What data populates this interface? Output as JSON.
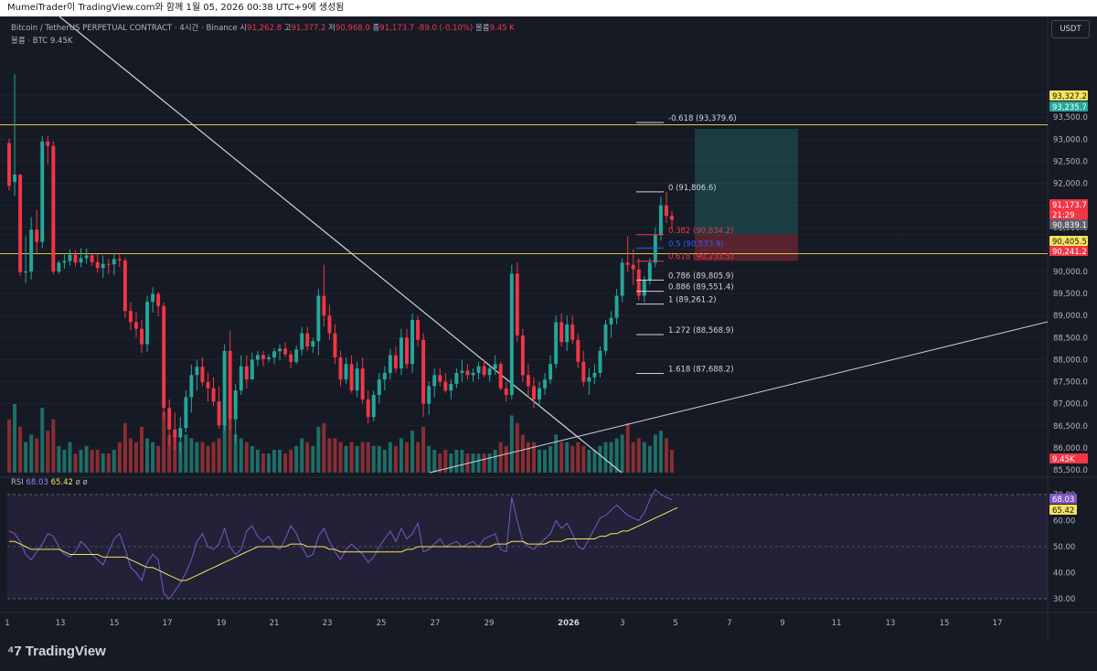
{
  "header": {
    "caption": "MumeiTrader이 TradingView.com와 함께 1월 05, 2026 00:38 UTC+9에 생성됨"
  },
  "legend": {
    "symbol": "Bitcoin / TetherUS PERPETUAL CONTRACT · 4시간 · Binance",
    "o_label": "시",
    "o_value": "91,262.8",
    "h_label": "고",
    "h_value": "91,377.2",
    "l_label": "저",
    "l_value": "90,968.0",
    "c_label": "종",
    "c_value": "91,173.7",
    "change": "-89.0 (-0.10%)",
    "vol_label": "볼륨",
    "vol_value": "9.45 K",
    "vol2_label": "볼륨 · BTC",
    "vol2_value": "9.45K"
  },
  "rsi_legend": {
    "label": "RSI",
    "rsi": "68.03",
    "ma": "65.42",
    "extra": "ø ø"
  },
  "currency": "USDT",
  "brand": "TradingView",
  "colors": {
    "bg": "#161a25",
    "up": "#26a69a",
    "down": "#f23645",
    "up_vol": "#1e6e67",
    "down_vol": "#8a2e33",
    "rsi": "#7e57c2",
    "rsi_ma": "#f7e35c",
    "fib": "#d1d4dc"
  },
  "chart_data": {
    "type": "candlestick",
    "price_axis": {
      "min": 85500,
      "max": 94500,
      "ticks": [
        "94,000.0",
        "93,500.0",
        "93,000.0",
        "92,500.0",
        "92,000.0",
        "91,500.0",
        "91,000.0",
        "90,500.0",
        "90,000.0",
        "89,500.0",
        "89,000.0",
        "88,500.0",
        "88,000.0",
        "87,500.0",
        "87,000.0",
        "86,500.0",
        "86,000.0",
        "85,500.0"
      ]
    },
    "time_axis": [
      "1",
      "13",
      "15",
      "17",
      "19",
      "21",
      "23",
      "25",
      "27",
      "29",
      "2026",
      "3",
      "5",
      "7",
      "9",
      "11",
      "13",
      "15",
      "17"
    ],
    "price_tags": [
      {
        "label": "93,327.2",
        "kind": "yellow"
      },
      {
        "label": "93,235.7",
        "kind": "teal"
      },
      {
        "label": "91,173.7",
        "kind": "red"
      },
      {
        "label": "21:29",
        "kind": "red"
      },
      {
        "label": "90,839.1",
        "kind": "gray"
      },
      {
        "label": "90,405.5",
        "kind": "yellow"
      },
      {
        "label": "90,241.2",
        "kind": "red"
      },
      {
        "label": "9.45K",
        "kind": "red"
      }
    ],
    "horizontal_levels": [
      93327.2,
      90405.5
    ],
    "fib_levels": [
      {
        "label": "-0.618 (93,379.6)",
        "price": 93379.6,
        "color": "#d1d4dc"
      },
      {
        "label": "0 (91,806.6)",
        "price": 91806.6,
        "color": "#d1d4dc"
      },
      {
        "label": "0.382 (90,834.2)",
        "price": 90834.2,
        "color": "#f23645"
      },
      {
        "label": "0.5 (90,533.9)",
        "price": 90533.9,
        "color": "#2962ff"
      },
      {
        "label": "0.618 (90,233.5)",
        "price": 90233.5,
        "color": "#f23645"
      },
      {
        "label": "0.786 (89,805.9)",
        "price": 89805.9,
        "color": "#d1d4dc"
      },
      {
        "label": "0.886 (89,551.4)",
        "price": 89551.4,
        "color": "#d1d4dc"
      },
      {
        "label": "1 (89,261.2)",
        "price": 89261.2,
        "color": "#d1d4dc"
      },
      {
        "label": "1.272 (88,568.9)",
        "price": 88568.9,
        "color": "#d1d4dc"
      },
      {
        "label": "1.618 (87,688.2)",
        "price": 87688.2,
        "color": "#d1d4dc"
      }
    ],
    "position": {
      "entry": 90839.1,
      "target": 93235.7,
      "stop": 90241.2
    },
    "rsi_axis": {
      "ticks": [
        "70.00",
        "60.00",
        "50.00",
        "40.00",
        "30.00"
      ],
      "upper": 70,
      "lower": 30
    },
    "rsi_tags": [
      "68.03",
      "65.42"
    ],
    "candles": [
      [
        92913,
        93021,
        91838,
        91944,
        14
      ],
      [
        92032,
        94477,
        91713,
        92200,
        18
      ],
      [
        92200,
        92200,
        89901,
        89986,
        12
      ],
      [
        89986,
        90800,
        89735,
        90000,
        8
      ],
      [
        90000,
        91234,
        89820,
        90949,
        10
      ],
      [
        90949,
        91400,
        90410,
        90670,
        9
      ],
      [
        90670,
        93071,
        90528,
        92950,
        17
      ],
      [
        92950,
        93075,
        92426,
        92850,
        11
      ],
      [
        92850,
        92954,
        89933,
        90000,
        14
      ],
      [
        90000,
        90246,
        89943,
        90200,
        7
      ],
      [
        90200,
        90383,
        90060,
        90238,
        6
      ],
      [
        90238,
        90503,
        90134,
        90377,
        8
      ],
      [
        90377,
        90478,
        90113,
        90205,
        5
      ],
      [
        90205,
        90530,
        90100,
        90303,
        6
      ],
      [
        90303,
        90522,
        90172,
        90364,
        7
      ],
      [
        90364,
        90405,
        90125,
        90212,
        6
      ],
      [
        90212,
        90400,
        89976,
        90079,
        6
      ],
      [
        90079,
        90364,
        89850,
        90172,
        5
      ],
      [
        90172,
        90284,
        89950,
        90162,
        5
      ],
      [
        90162,
        90400,
        89919,
        90284,
        6
      ],
      [
        90284,
        90432,
        90100,
        90251,
        8
      ],
      [
        90251,
        90317,
        88944,
        89105,
        13
      ],
      [
        89105,
        89300,
        88672,
        88850,
        9
      ],
      [
        88850,
        89080,
        88506,
        88700,
        8
      ],
      [
        88700,
        88900,
        88150,
        88350,
        12
      ],
      [
        88350,
        89451,
        88180,
        89315,
        9
      ],
      [
        89315,
        89641,
        89071,
        89491,
        8
      ],
      [
        89491,
        89541,
        88986,
        89216,
        7
      ],
      [
        89216,
        89300,
        86650,
        86907,
        16
      ],
      [
        86907,
        87100,
        86040,
        86414,
        10
      ],
      [
        86414,
        86800,
        85950,
        86236,
        11
      ],
      [
        86236,
        86700,
        85900,
        86450,
        8
      ],
      [
        86450,
        87300,
        86350,
        87150,
        10
      ],
      [
        87150,
        87888,
        86800,
        87650,
        9
      ],
      [
        87650,
        88000,
        87300,
        87839,
        8
      ],
      [
        87839,
        88050,
        87400,
        87489,
        8
      ],
      [
        87489,
        87700,
        87050,
        87350,
        7
      ],
      [
        87350,
        87600,
        86950,
        87050,
        8
      ],
      [
        87050,
        87400,
        86430,
        86514,
        9
      ],
      [
        86514,
        88350,
        86400,
        88200,
        16
      ],
      [
        88200,
        88650,
        86400,
        86650,
        15
      ],
      [
        86650,
        87450,
        86100,
        87300,
        10
      ],
      [
        87300,
        88100,
        87200,
        87850,
        9
      ],
      [
        87850,
        88100,
        87350,
        87550,
        8
      ],
      [
        87550,
        88160,
        87600,
        88000,
        7
      ],
      [
        88000,
        88200,
        87850,
        88106,
        6
      ],
      [
        88106,
        88200,
        87850,
        88013,
        5
      ],
      [
        88013,
        88120,
        87940,
        88050,
        5
      ],
      [
        88050,
        88260,
        87900,
        88190,
        6
      ],
      [
        88190,
        88350,
        87980,
        88250,
        6
      ],
      [
        88250,
        88400,
        88050,
        88120,
        5
      ],
      [
        88120,
        88200,
        87800,
        87950,
        6
      ],
      [
        87950,
        88320,
        87900,
        88230,
        7
      ],
      [
        88230,
        88740,
        88100,
        88600,
        9
      ],
      [
        88600,
        88750,
        88200,
        88300,
        8
      ],
      [
        88300,
        88500,
        88150,
        88420,
        7
      ],
      [
        88420,
        89600,
        88100,
        89450,
        12
      ],
      [
        89450,
        90150,
        88750,
        89000,
        13
      ],
      [
        89000,
        89250,
        88450,
        88600,
        9
      ],
      [
        88600,
        88800,
        87900,
        88050,
        9
      ],
      [
        88050,
        88200,
        87400,
        87550,
        8
      ],
      [
        87550,
        88050,
        87450,
        87900,
        7
      ],
      [
        87900,
        88100,
        87250,
        87300,
        8
      ],
      [
        87300,
        87950,
        87150,
        87800,
        7
      ],
      [
        87800,
        88050,
        87000,
        87100,
        8
      ],
      [
        87100,
        87300,
        86550,
        86700,
        8
      ],
      [
        86700,
        87300,
        86600,
        87200,
        7
      ],
      [
        87200,
        87700,
        87000,
        87550,
        7
      ],
      [
        87550,
        87850,
        87300,
        87700,
        6
      ],
      [
        87700,
        88250,
        87550,
        88100,
        8
      ],
      [
        88100,
        88300,
        87700,
        87800,
        7
      ],
      [
        87800,
        88700,
        87650,
        88500,
        9
      ],
      [
        88500,
        88700,
        87800,
        87900,
        8
      ],
      [
        87900,
        89050,
        87700,
        88900,
        11
      ],
      [
        88900,
        89000,
        88300,
        88450,
        8
      ],
      [
        88450,
        88600,
        86700,
        87000,
        12
      ],
      [
        87000,
        87500,
        86750,
        87400,
        7
      ],
      [
        87400,
        87800,
        87150,
        87650,
        6
      ],
      [
        87650,
        87800,
        87400,
        87500,
        5
      ],
      [
        87500,
        87700,
        87250,
        87300,
        6
      ],
      [
        87300,
        87550,
        87100,
        87450,
        5
      ],
      [
        87450,
        87800,
        87350,
        87700,
        6
      ],
      [
        87700,
        88000,
        87500,
        87750,
        6
      ],
      [
        87750,
        87900,
        87550,
        87650,
        5
      ],
      [
        87650,
        87800,
        87500,
        87700,
        5
      ],
      [
        87700,
        87950,
        87550,
        87850,
        5
      ],
      [
        87850,
        88000,
        87600,
        87650,
        5
      ],
      [
        87650,
        87900,
        87500,
        87800,
        5
      ],
      [
        87800,
        88100,
        87650,
        87900,
        6
      ],
      [
        87900,
        87950,
        87300,
        87350,
        8
      ],
      [
        87350,
        87500,
        87050,
        87200,
        7
      ],
      [
        87200,
        90150,
        87100,
        89950,
        15
      ],
      [
        89950,
        90200,
        88400,
        88550,
        13
      ],
      [
        88550,
        88700,
        87500,
        87650,
        10
      ],
      [
        87650,
        87900,
        87150,
        87400,
        8
      ],
      [
        87400,
        87600,
        86900,
        87100,
        8
      ],
      [
        87100,
        87500,
        86950,
        87350,
        6
      ],
      [
        87350,
        87700,
        87200,
        87550,
        6
      ],
      [
        87550,
        88100,
        87450,
        87900,
        7
      ],
      [
        87900,
        89000,
        87800,
        88850,
        10
      ],
      [
        88850,
        89050,
        88300,
        88400,
        8
      ],
      [
        88400,
        89000,
        88200,
        88800,
        8
      ],
      [
        88800,
        89000,
        88350,
        88450,
        7
      ],
      [
        88450,
        88600,
        87800,
        87950,
        8
      ],
      [
        87950,
        88200,
        87400,
        87500,
        7
      ],
      [
        87500,
        87800,
        87200,
        87600,
        6
      ],
      [
        87600,
        87900,
        87450,
        87700,
        6
      ],
      [
        87700,
        88300,
        87600,
        88200,
        7
      ],
      [
        88200,
        88900,
        88100,
        88800,
        8
      ],
      [
        88800,
        89100,
        88500,
        88950,
        8
      ],
      [
        88950,
        89600,
        88800,
        89450,
        9
      ],
      [
        89450,
        90300,
        89300,
        90200,
        10
      ],
      [
        90200,
        90800,
        90000,
        90150,
        13
      ],
      [
        90150,
        90500,
        89700,
        90050,
        8
      ],
      [
        90050,
        90300,
        89350,
        89450,
        9
      ],
      [
        89450,
        89900,
        89300,
        89800,
        8
      ],
      [
        89800,
        90300,
        89700,
        90200,
        7
      ],
      [
        90200,
        91000,
        90100,
        90840,
        10
      ],
      [
        90840,
        91700,
        90700,
        91500,
        11
      ],
      [
        91500,
        91806,
        91100,
        91262,
        9
      ],
      [
        91262,
        91377,
        90968,
        91174,
        6
      ]
    ],
    "rsi": [
      56,
      55,
      52,
      47,
      45,
      48,
      51,
      55,
      54,
      50,
      47,
      46,
      48,
      52,
      50,
      47,
      45,
      43,
      48,
      53,
      55,
      49,
      42,
      40,
      37,
      44,
      47,
      45,
      32,
      30,
      33,
      36,
      40,
      45,
      52,
      55,
      50,
      49,
      51,
      57,
      50,
      47,
      49,
      56,
      58,
      54,
      52,
      54,
      50,
      49,
      53,
      58,
      55,
      50,
      46,
      47,
      54,
      57,
      52,
      48,
      45,
      49,
      51,
      49,
      47,
      44,
      46,
      50,
      53,
      56,
      52,
      57,
      53,
      55,
      59,
      48,
      49,
      51,
      53,
      50,
      51,
      52,
      50,
      51,
      52,
      50,
      53,
      54,
      55,
      49,
      48,
      69,
      60,
      52,
      50,
      49,
      51,
      53,
      55,
      60,
      57,
      59,
      55,
      50,
      49,
      53,
      57,
      61,
      62,
      64,
      66,
      64,
      62,
      61,
      60,
      63,
      68,
      72,
      70,
      69,
      68
    ],
    "rsi_ma": [
      52,
      52,
      51,
      50,
      49,
      49,
      49,
      49,
      49,
      49,
      48,
      47,
      47,
      47,
      47,
      47,
      47,
      46,
      46,
      46,
      46,
      46,
      45,
      44,
      43,
      42,
      42,
      41,
      40,
      39,
      38,
      37,
      37,
      38,
      39,
      40,
      41,
      42,
      43,
      44,
      45,
      46,
      47,
      48,
      49,
      50,
      50,
      50,
      50,
      50,
      50,
      51,
      51,
      51,
      50,
      50,
      50,
      50,
      49,
      49,
      48,
      48,
      48,
      48,
      48,
      48,
      48,
      48,
      48,
      48,
      48,
      48,
      49,
      49,
      50,
      50,
      50,
      50,
      50,
      50,
      50,
      50,
      50,
      50,
      50,
      50,
      50,
      50,
      51,
      51,
      51,
      52,
      52,
      52,
      51,
      51,
      51,
      51,
      52,
      52,
      52,
      53,
      53,
      53,
      53,
      53,
      53,
      54,
      54,
      55,
      55,
      56,
      56,
      57,
      58,
      59,
      60,
      61,
      62,
      63,
      64,
      65
    ]
  }
}
